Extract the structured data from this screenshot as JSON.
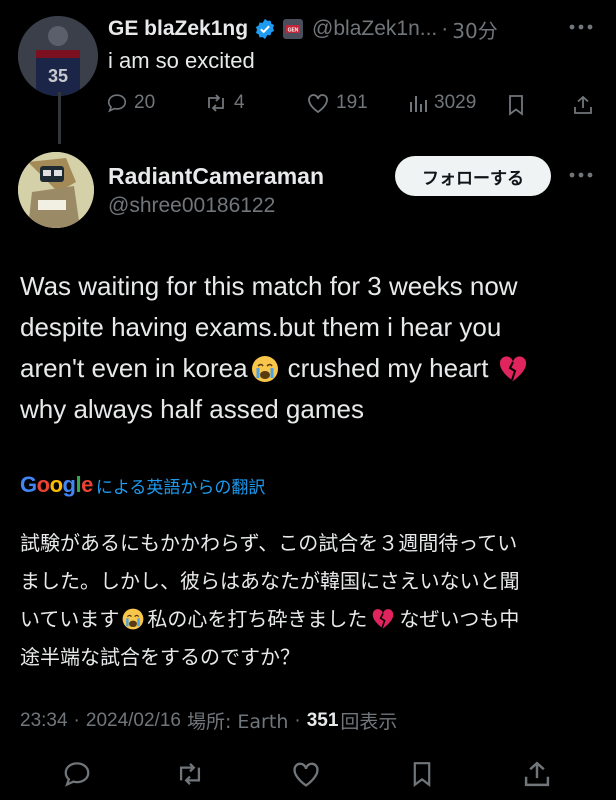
{
  "parent_post": {
    "display_name": "GE blaZek1ng",
    "handle": "@blaZek1n...",
    "separator": "·",
    "time": "30分",
    "text": "i am so excited",
    "jersey_number": "35",
    "stats": {
      "replies": "20",
      "reposts": "4",
      "likes": "191",
      "views": "3029"
    }
  },
  "main_post": {
    "display_name": "RadiantCameraman",
    "handle": "@shree00186122",
    "follow_label": "フォローする",
    "text_lines": [
      "Was waiting for this match for 3 weeks now",
      "despite having exams.but them i hear you",
      "aren't even in korea",
      "crushed my heart",
      "why always half assed games"
    ],
    "translation_label": "による英語からの翻訳",
    "translation_brand": "Google",
    "translation_lines": [
      "試験があるにもかかわらず、この試合を３週間待ってい",
      "ました。しかし、彼らはあなたが韓国にさえいないと聞",
      "いています",
      "私の心を打ち砕きました",
      "なぜいつも中",
      "途半端な試合をするのですか？"
    ],
    "meta": {
      "time": "23:34",
      "sep": "·",
      "date": "2024/02/16",
      "location": "場所: Earth",
      "views_count": "351",
      "views_label": "回表示"
    }
  },
  "colors": {
    "verified": "#1d9bf0",
    "link": "#1d9bf0",
    "muted": "#71767b",
    "emoji_heart": "#e0245e"
  },
  "icons": [
    "reply-icon",
    "repost-icon",
    "like-icon",
    "views-icon",
    "bookmark-icon",
    "share-icon",
    "more-icon",
    "verified-icon"
  ]
}
